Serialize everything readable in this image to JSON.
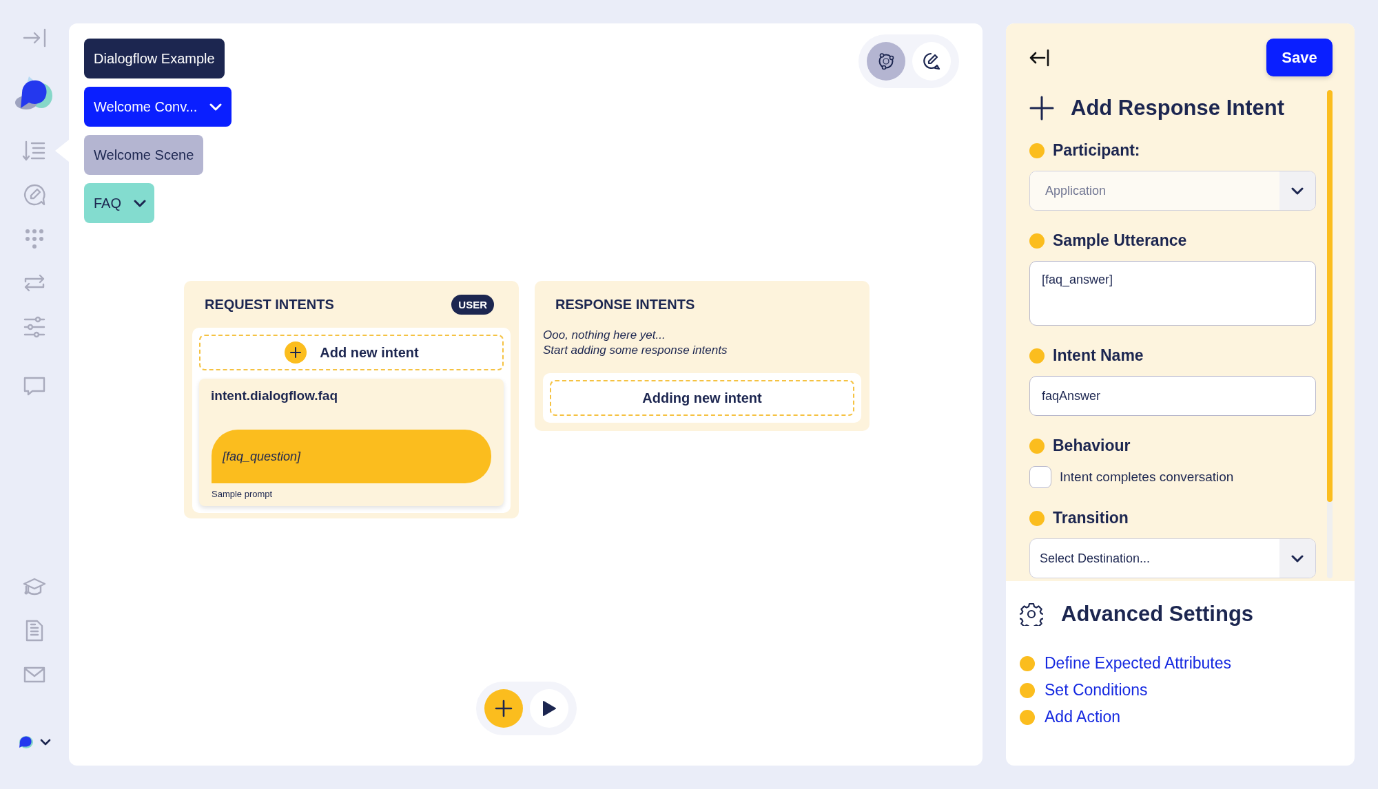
{
  "sidebar": {
    "items": [
      {
        "selected": false
      },
      {
        "selected": true
      },
      {
        "selected": false
      },
      {
        "selected": false
      },
      {
        "selected": false
      },
      {
        "selected": false
      },
      {
        "selected": false
      },
      {
        "selected": false
      },
      {
        "selected": false
      },
      {
        "selected": false
      }
    ]
  },
  "breadcrumbs": [
    {
      "label": "Dialogflow Example",
      "kind": "project",
      "dropdown": false
    },
    {
      "label": "Welcome Conv...",
      "kind": "conversation",
      "dropdown": true
    },
    {
      "label": "Welcome Scene",
      "kind": "scene",
      "dropdown": false
    },
    {
      "label": "FAQ",
      "kind": "intent",
      "dropdown": true
    }
  ],
  "view_toggles": [
    {
      "selected": true
    },
    {
      "selected": false
    }
  ],
  "request_intents": {
    "title": "REQUEST INTENTS",
    "badge": "USER",
    "add_button": "Add new intent",
    "intents": [
      {
        "name": "intent.dialogflow.faq",
        "utterance": "[faq_question]",
        "caption": "Sample prompt"
      }
    ]
  },
  "response_intents": {
    "title": "RESPONSE INTENTS",
    "empty_message": [
      "Ooo, nothing here yet...",
      "Start adding some response intents"
    ],
    "add_button": "Adding new intent"
  },
  "panel": {
    "save_button": "Save",
    "title": "Add Response Intent",
    "fields": [
      {
        "kind": "select",
        "label": "Participant:",
        "value": "Application",
        "disabled": true
      },
      {
        "kind": "textarea",
        "label": "Sample Utterance",
        "value": "[faq_answer]"
      },
      {
        "kind": "input",
        "label": "Intent Name",
        "value": "faqAnswer"
      },
      {
        "kind": "checkbox",
        "label": "Behaviour",
        "option": "Intent completes conversation",
        "checked": false
      },
      {
        "kind": "select",
        "label": "Transition",
        "value": "Select Destination...",
        "disabled": false
      }
    ]
  },
  "advanced_settings": {
    "title": "Advanced Settings",
    "links": [
      "Define Expected Attributes",
      "Set Conditions",
      "Add Action"
    ]
  }
}
